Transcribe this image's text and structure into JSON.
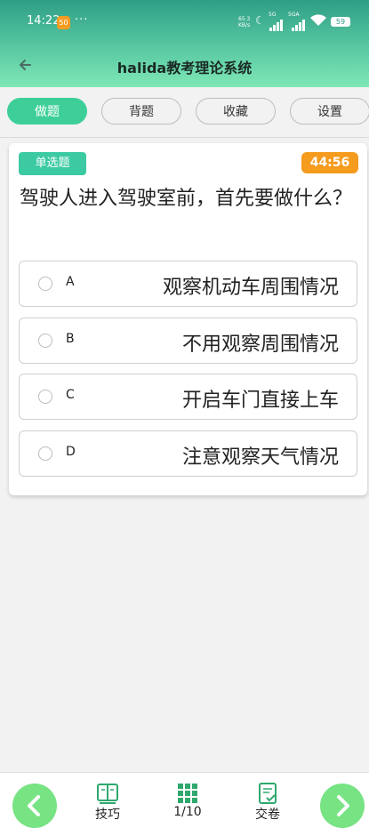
{
  "status_bar": {
    "time": "14:22",
    "notification_badge": "50",
    "dots": "···",
    "net_speed_top": "65.3",
    "net_speed_bottom": "KB/s",
    "sig1_label": "5G",
    "sig2_label": "5GA",
    "battery": "59"
  },
  "header": {
    "title": "halida教考理论系统"
  },
  "tabs": [
    {
      "label": "做题",
      "active": true
    },
    {
      "label": "背题",
      "active": false
    },
    {
      "label": "收藏",
      "active": false
    },
    {
      "label": "设置",
      "active": false
    }
  ],
  "question": {
    "type_badge": "单选题",
    "timer": "44:56",
    "text": "驾驶人进入驾驶室前，首先要做什么？",
    "options": [
      {
        "label": "A",
        "text": "观察机动车周围情况"
      },
      {
        "label": "B",
        "text": "不用观察周围情况"
      },
      {
        "label": "C",
        "text": "开启车门直接上车"
      },
      {
        "label": "D",
        "text": "注意观察天气情况"
      }
    ]
  },
  "bottom_nav": {
    "tips_label": "技巧",
    "progress_label": "1/10",
    "submit_label": "交卷"
  },
  "colors": {
    "accent": "#3ecf98",
    "header_start": "#2f9e86",
    "header_end": "#80e7b6",
    "timer_bg": "#f59b1e",
    "nav_button": "#77e383"
  },
  "icons": {
    "back": "arrow-left-icon",
    "prev": "chevron-left-icon",
    "next": "chevron-right-icon",
    "tips": "book-icon",
    "progress": "grid-icon",
    "submit": "document-check-icon"
  }
}
